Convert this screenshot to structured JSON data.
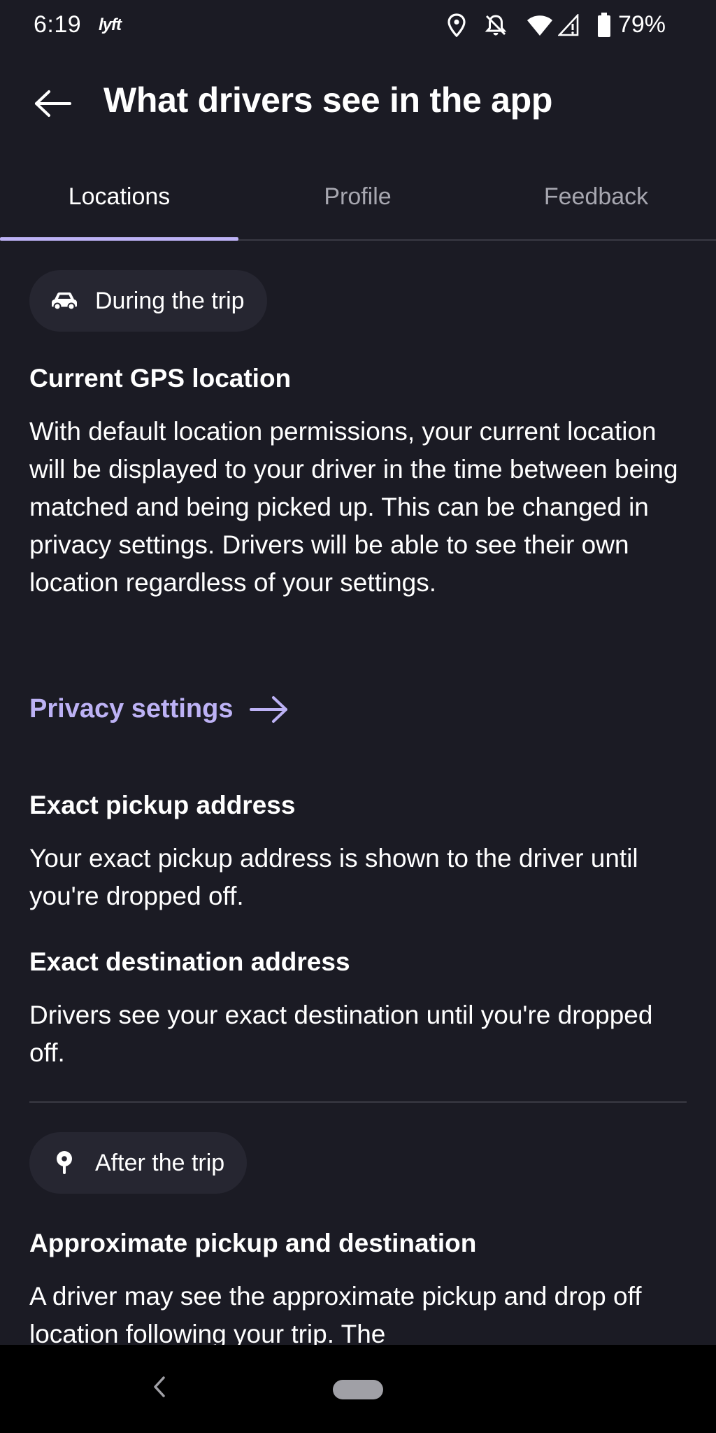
{
  "status_bar": {
    "time": "6:19",
    "app_badge": "lyft",
    "battery": "79%",
    "icons": [
      "location-icon",
      "notifications-off-icon",
      "wifi-icon",
      "signal-icon",
      "battery-icon"
    ]
  },
  "header": {
    "back_icon": "back-arrow-icon",
    "title": "What drivers see in the app"
  },
  "tabs": [
    {
      "label": "Locations",
      "active": true
    },
    {
      "label": "Profile",
      "active": false
    },
    {
      "label": "Feedback",
      "active": false
    }
  ],
  "during_trip": {
    "chip_icon": "car-icon",
    "chip_label": "During the trip",
    "gps": {
      "title": "Current GPS location",
      "body": "With default location permissions, your current location will be displayed to your driver in the time between being matched and being picked up. This can be changed in privacy settings. Drivers will be able to see their own location regardless of your settings."
    },
    "privacy_link": "Privacy settings",
    "pickup": {
      "title": "Exact pickup address",
      "body": "Your exact pickup address is shown to the driver until you're dropped off."
    },
    "destination": {
      "title": "Exact destination address",
      "body": "Drivers see your exact destination until you're dropped off."
    }
  },
  "after_trip": {
    "chip_icon": "map-pin-icon",
    "chip_label": "After the trip",
    "approx": {
      "title": "Approximate pickup and destination",
      "body": "A driver may see the approximate pickup and drop off location following your trip. The"
    }
  },
  "colors": {
    "background": "#1b1b24",
    "chip": "#262631",
    "accent": "#bdb2f5",
    "muted_text": "#a7a7b0"
  }
}
